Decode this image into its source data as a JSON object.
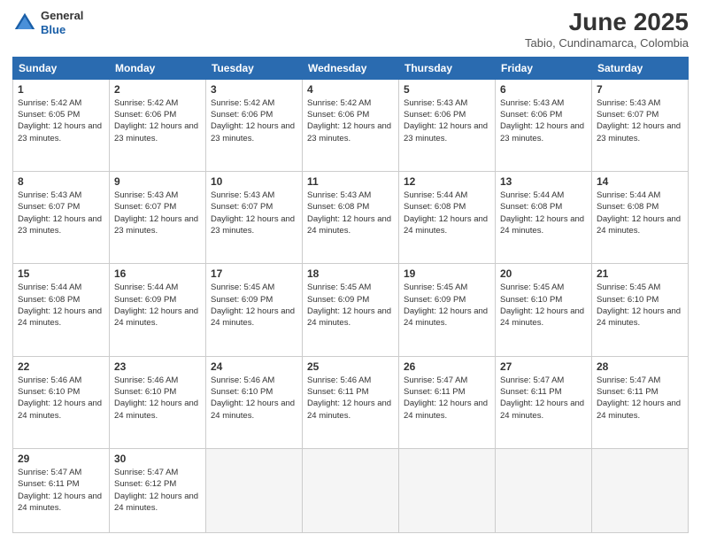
{
  "header": {
    "logo": {
      "general": "General",
      "blue": "Blue"
    },
    "title": "June 2025",
    "location": "Tabio, Cundinamarca, Colombia"
  },
  "weekdays": [
    "Sunday",
    "Monday",
    "Tuesday",
    "Wednesday",
    "Thursday",
    "Friday",
    "Saturday"
  ],
  "weeks": [
    [
      {
        "day": "1",
        "sunrise": "5:42 AM",
        "sunset": "6:05 PM",
        "daylight": "12 hours and 23 minutes."
      },
      {
        "day": "2",
        "sunrise": "5:42 AM",
        "sunset": "6:06 PM",
        "daylight": "12 hours and 23 minutes."
      },
      {
        "day": "3",
        "sunrise": "5:42 AM",
        "sunset": "6:06 PM",
        "daylight": "12 hours and 23 minutes."
      },
      {
        "day": "4",
        "sunrise": "5:42 AM",
        "sunset": "6:06 PM",
        "daylight": "12 hours and 23 minutes."
      },
      {
        "day": "5",
        "sunrise": "5:43 AM",
        "sunset": "6:06 PM",
        "daylight": "12 hours and 23 minutes."
      },
      {
        "day": "6",
        "sunrise": "5:43 AM",
        "sunset": "6:06 PM",
        "daylight": "12 hours and 23 minutes."
      },
      {
        "day": "7",
        "sunrise": "5:43 AM",
        "sunset": "6:07 PM",
        "daylight": "12 hours and 23 minutes."
      }
    ],
    [
      {
        "day": "8",
        "sunrise": "5:43 AM",
        "sunset": "6:07 PM",
        "daylight": "12 hours and 23 minutes."
      },
      {
        "day": "9",
        "sunrise": "5:43 AM",
        "sunset": "6:07 PM",
        "daylight": "12 hours and 23 minutes."
      },
      {
        "day": "10",
        "sunrise": "5:43 AM",
        "sunset": "6:07 PM",
        "daylight": "12 hours and 23 minutes."
      },
      {
        "day": "11",
        "sunrise": "5:43 AM",
        "sunset": "6:08 PM",
        "daylight": "12 hours and 24 minutes."
      },
      {
        "day": "12",
        "sunrise": "5:44 AM",
        "sunset": "6:08 PM",
        "daylight": "12 hours and 24 minutes."
      },
      {
        "day": "13",
        "sunrise": "5:44 AM",
        "sunset": "6:08 PM",
        "daylight": "12 hours and 24 minutes."
      },
      {
        "day": "14",
        "sunrise": "5:44 AM",
        "sunset": "6:08 PM",
        "daylight": "12 hours and 24 minutes."
      }
    ],
    [
      {
        "day": "15",
        "sunrise": "5:44 AM",
        "sunset": "6:08 PM",
        "daylight": "12 hours and 24 minutes."
      },
      {
        "day": "16",
        "sunrise": "5:44 AM",
        "sunset": "6:09 PM",
        "daylight": "12 hours and 24 minutes."
      },
      {
        "day": "17",
        "sunrise": "5:45 AM",
        "sunset": "6:09 PM",
        "daylight": "12 hours and 24 minutes."
      },
      {
        "day": "18",
        "sunrise": "5:45 AM",
        "sunset": "6:09 PM",
        "daylight": "12 hours and 24 minutes."
      },
      {
        "day": "19",
        "sunrise": "5:45 AM",
        "sunset": "6:09 PM",
        "daylight": "12 hours and 24 minutes."
      },
      {
        "day": "20",
        "sunrise": "5:45 AM",
        "sunset": "6:10 PM",
        "daylight": "12 hours and 24 minutes."
      },
      {
        "day": "21",
        "sunrise": "5:45 AM",
        "sunset": "6:10 PM",
        "daylight": "12 hours and 24 minutes."
      }
    ],
    [
      {
        "day": "22",
        "sunrise": "5:46 AM",
        "sunset": "6:10 PM",
        "daylight": "12 hours and 24 minutes."
      },
      {
        "day": "23",
        "sunrise": "5:46 AM",
        "sunset": "6:10 PM",
        "daylight": "12 hours and 24 minutes."
      },
      {
        "day": "24",
        "sunrise": "5:46 AM",
        "sunset": "6:10 PM",
        "daylight": "12 hours and 24 minutes."
      },
      {
        "day": "25",
        "sunrise": "5:46 AM",
        "sunset": "6:11 PM",
        "daylight": "12 hours and 24 minutes."
      },
      {
        "day": "26",
        "sunrise": "5:47 AM",
        "sunset": "6:11 PM",
        "daylight": "12 hours and 24 minutes."
      },
      {
        "day": "27",
        "sunrise": "5:47 AM",
        "sunset": "6:11 PM",
        "daylight": "12 hours and 24 minutes."
      },
      {
        "day": "28",
        "sunrise": "5:47 AM",
        "sunset": "6:11 PM",
        "daylight": "12 hours and 24 minutes."
      }
    ],
    [
      {
        "day": "29",
        "sunrise": "5:47 AM",
        "sunset": "6:11 PM",
        "daylight": "12 hours and 24 minutes."
      },
      {
        "day": "30",
        "sunrise": "5:47 AM",
        "sunset": "6:12 PM",
        "daylight": "12 hours and 24 minutes."
      },
      null,
      null,
      null,
      null,
      null
    ]
  ]
}
